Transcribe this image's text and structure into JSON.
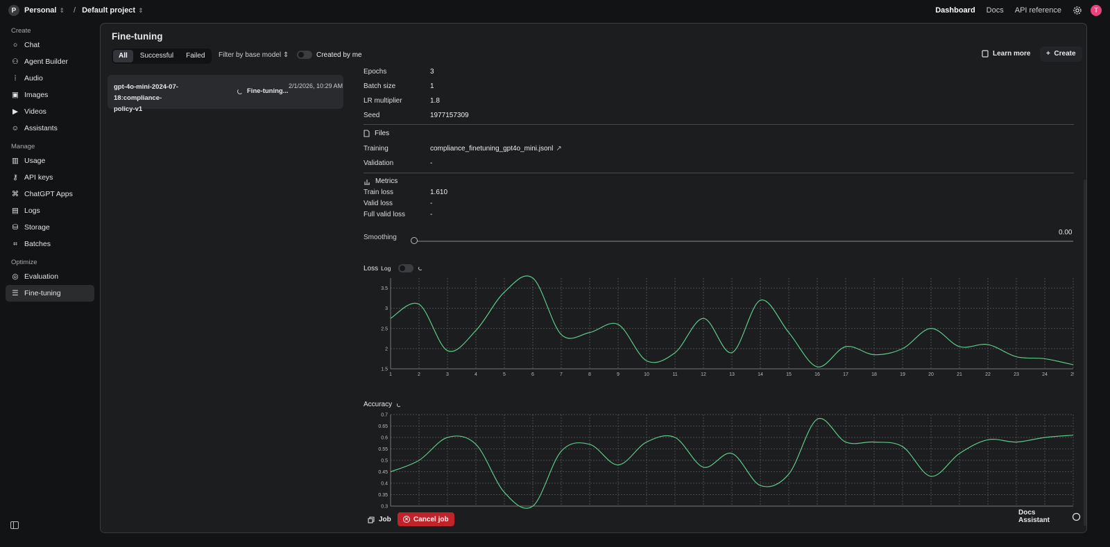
{
  "topbar": {
    "org_initial": "P",
    "org": "Personal",
    "separator": "/",
    "project": "Default project",
    "nav": [
      "Dashboard",
      "Docs",
      "API reference"
    ],
    "avatar_initial": "T"
  },
  "sidebar": {
    "sections": [
      {
        "title": "Create",
        "items": [
          {
            "label": "Chat",
            "icon": "chat-icon"
          },
          {
            "label": "Agent Builder",
            "icon": "agent-icon"
          },
          {
            "label": "Audio",
            "icon": "audio-icon"
          },
          {
            "label": "Images",
            "icon": "image-icon"
          },
          {
            "label": "Videos",
            "icon": "video-icon"
          },
          {
            "label": "Assistants",
            "icon": "assistant-icon"
          }
        ]
      },
      {
        "title": "Manage",
        "items": [
          {
            "label": "Usage",
            "icon": "usage-icon"
          },
          {
            "label": "API keys",
            "icon": "key-icon"
          },
          {
            "label": "ChatGPT Apps",
            "icon": "apps-icon"
          },
          {
            "label": "Logs",
            "icon": "logs-icon"
          },
          {
            "label": "Storage",
            "icon": "storage-icon"
          },
          {
            "label": "Batches",
            "icon": "batches-icon"
          }
        ]
      },
      {
        "title": "Optimize",
        "items": [
          {
            "label": "Evaluation",
            "icon": "evaluation-icon"
          },
          {
            "label": "Fine-tuning",
            "icon": "tuning-icon",
            "active": true
          }
        ]
      }
    ]
  },
  "main": {
    "title": "Fine-tuning",
    "tabs": [
      "All",
      "Successful",
      "Failed"
    ],
    "filter_label": "Filter by base model",
    "created_by_me": "Created by me",
    "learn_more": "Learn more",
    "create": "Create"
  },
  "job": {
    "name_line1": "gpt-4o-mini-2024-07-18:compliance-",
    "name_line2": "policy-v1",
    "status": "Fine-tuning...",
    "date": "2/1/2026, 10:29 AM"
  },
  "details": {
    "hyper": [
      {
        "k": "Epochs",
        "v": "3"
      },
      {
        "k": "Batch size",
        "v": "1"
      },
      {
        "k": "LR multiplier",
        "v": "1.8"
      },
      {
        "k": "Seed",
        "v": "1977157309"
      }
    ],
    "files_title": "Files",
    "files": [
      {
        "k": "Training",
        "v": "compliance_finetuning_gpt4o_mini.jsonl"
      },
      {
        "k": "Validation",
        "v": "-"
      }
    ],
    "metrics_title": "Metrics",
    "metrics": [
      {
        "k": "Train loss",
        "v": "1.610"
      },
      {
        "k": "Valid loss",
        "v": "-"
      },
      {
        "k": "Full valid loss",
        "v": "-"
      }
    ],
    "smoothing_label": "Smoothing",
    "smoothing_value": "0.00",
    "loss_label": "Loss",
    "log_label": "Log",
    "accuracy_label": "Accuracy"
  },
  "footer": {
    "job": "Job",
    "cancel": "Cancel job",
    "docs_assistant": "Docs Assistant"
  },
  "colors": {
    "line": "#5fc98a",
    "cancel": "#c0232a",
    "avatar": "#e8437a"
  },
  "chart_data": [
    {
      "type": "line",
      "title": "Loss",
      "x": [
        1,
        2,
        3,
        4,
        5,
        6,
        7,
        8,
        9,
        10,
        11,
        12,
        13,
        14,
        15,
        16,
        17,
        18,
        19,
        20,
        21,
        22,
        23,
        24,
        25
      ],
      "series": [
        {
          "values": [
            2.75,
            3.1,
            1.95,
            2.45,
            3.4,
            3.75,
            2.35,
            2.4,
            2.6,
            1.7,
            1.9,
            2.75,
            1.9,
            3.2,
            2.4,
            1.55,
            2.05,
            1.85,
            2.0,
            2.5,
            2.05,
            2.1,
            1.8,
            1.75,
            1.6
          ]
        }
      ],
      "ylim": [
        1.5,
        3.75
      ],
      "yticks": [
        1.5,
        2,
        2.5,
        3,
        3.5
      ],
      "grid": true
    },
    {
      "type": "line",
      "title": "Accuracy",
      "x": [
        1,
        2,
        3,
        4,
        5,
        6,
        7,
        8,
        9,
        10,
        11,
        12,
        13,
        14,
        15,
        16,
        17,
        18,
        19,
        20,
        21,
        22,
        23,
        24,
        25
      ],
      "series": [
        {
          "values": [
            0.45,
            0.5,
            0.6,
            0.57,
            0.36,
            0.3,
            0.54,
            0.57,
            0.48,
            0.58,
            0.6,
            0.47,
            0.53,
            0.39,
            0.44,
            0.68,
            0.58,
            0.58,
            0.56,
            0.43,
            0.53,
            0.59,
            0.58,
            0.6,
            0.61
          ]
        }
      ],
      "ylim": [
        0.3,
        0.7
      ],
      "yticks": [
        0.3,
        0.35,
        0.4,
        0.45,
        0.5,
        0.55,
        0.6,
        0.65,
        0.7
      ],
      "grid": true
    }
  ]
}
